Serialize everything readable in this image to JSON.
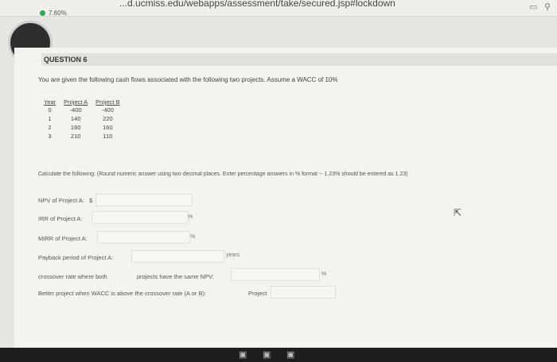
{
  "browser": {
    "url": "...d.ucmiss.edu/webapps/assessment/take/secured.jsp#lockdown"
  },
  "progress": {
    "percent_text": "7.60%"
  },
  "question": {
    "heading": "QUESTION 6",
    "prompt": "You are given the following cash flows associated with the following two projects. Assume a WACC of 10%",
    "table": {
      "headers": [
        "Year",
        "Project A",
        "Project B"
      ],
      "rows": [
        [
          "0",
          "-400",
          "-400"
        ],
        [
          "1",
          "140",
          "220"
        ],
        [
          "2",
          "160",
          "160"
        ],
        [
          "3",
          "210",
          "110"
        ]
      ]
    },
    "instructions": "Calculate the following: (Round numeric answer using two decimal places. Enter percentage answers in % format -- 1.23% should be entered as 1.23)"
  },
  "fields": {
    "npv": {
      "label": "NPV of Project A:",
      "prefix": "$"
    },
    "irr": {
      "label": "IRR of Project A:",
      "unit": "%"
    },
    "mirr": {
      "label": "MIRR of Project A:",
      "unit": "%"
    },
    "payback": {
      "label": "Payback period of Project A:",
      "unit": "years"
    },
    "crossover": {
      "label_1": "crossover rate where both",
      "label_2": "projects have the same NPV:",
      "unit": "%"
    },
    "better": {
      "label": "Better project when WACC is above the crossover rate (A or B):",
      "suffix": "Project"
    }
  }
}
